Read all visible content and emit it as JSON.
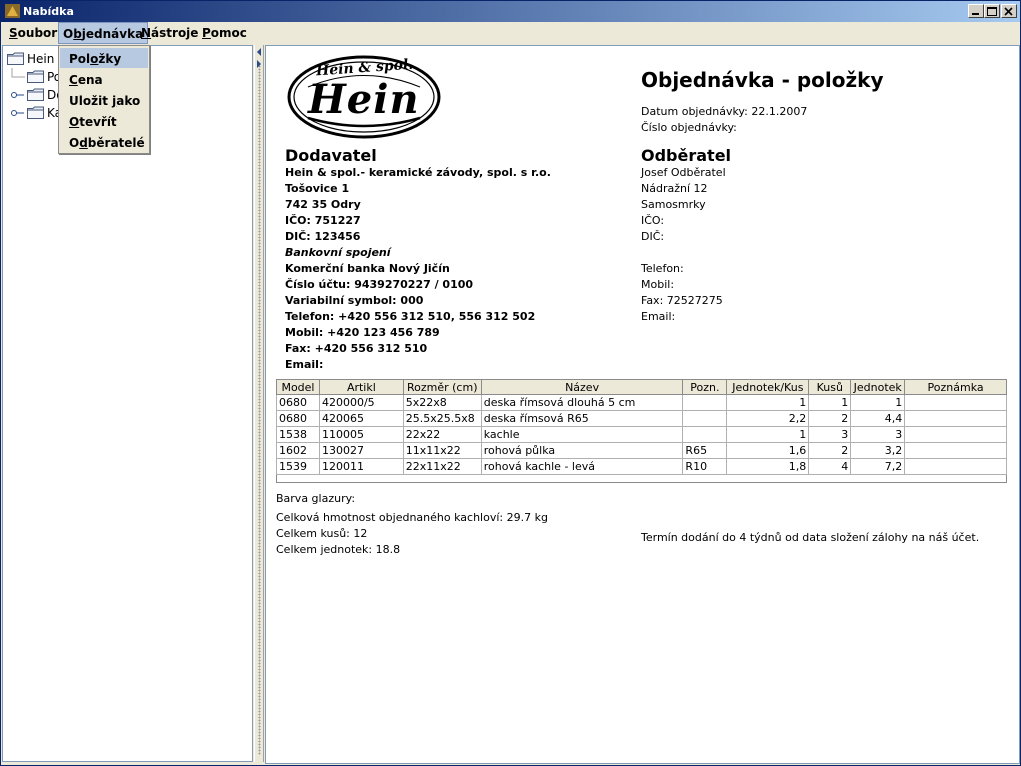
{
  "window": {
    "title": "Nabídka",
    "controls": [
      "minimize",
      "maximize",
      "close"
    ]
  },
  "menubar": {
    "items": [
      {
        "label_pre": "",
        "mnemonic": "S",
        "label_post": "oubor"
      },
      {
        "label_pre": "O",
        "mnemonic": "b",
        "label_post": "jednávka"
      },
      {
        "label_pre": "",
        "mnemonic": "N",
        "label_post": "ástroje"
      },
      {
        "label_pre": "",
        "mnemonic": "P",
        "label_post": "omoc"
      }
    ]
  },
  "dropdown": {
    "items": [
      {
        "label_pre": "Pol",
        "mnemonic": "o",
        "label_post": "žky"
      },
      {
        "label_pre": "",
        "mnemonic": "C",
        "label_post": "ena"
      },
      {
        "label_pre": "Uložit ",
        "mnemonic": "j",
        "label_post": "ako"
      },
      {
        "label_pre": "",
        "mnemonic": "O",
        "label_post": "tevřít"
      },
      {
        "label_pre": "O",
        "mnemonic": "d",
        "label_post": "běratelé"
      }
    ]
  },
  "tree": {
    "root": "Hein",
    "children": [
      "Po",
      "Do",
      "Ka"
    ]
  },
  "document": {
    "logo": {
      "top_text": "Hein & spol.",
      "main_text": "Hein"
    },
    "title": "Objednávka - položky",
    "order_date": "Datum objednávky: 22.1.2007",
    "order_number": "Číslo objednávky:",
    "supplier": {
      "heading": "Dodavatel",
      "lines": [
        "Hein & spol.- keramické závody, spol. s r.o.",
        "Tošovice 1",
        "742 35 Odry",
        "IČO: 751227",
        "DIČ: 123456"
      ],
      "bank_heading": "Bankovní spojení",
      "bank_lines": [
        "Komerční banka Nový Jičín",
        "Číslo účtu: 9439270227 / 0100",
        "Variabilní symbol: 000",
        "Telefon: +420 556 312 510, 556 312 502",
        "Mobil: +420 123 456 789",
        "Fax: +420 556 312 510",
        "Email:"
      ]
    },
    "customer": {
      "heading": "Odběratel",
      "lines": [
        "Josef Odběratel",
        "Nádražní 12",
        "Samosmrky",
        "IČO:",
        "DIČ:"
      ],
      "contact_lines": [
        "Telefon:",
        "Mobil:",
        "Fax: 72527275",
        "Email:"
      ]
    },
    "table": {
      "columns": [
        "Model",
        "Artikl",
        "Rozměr (cm)",
        "Název",
        "Pozn.",
        "Jednotek/Kus",
        "Kusů",
        "Jednotek",
        "Poznámka"
      ],
      "rows": [
        [
          "0680",
          "420000/5",
          "5x22x8",
          "deska římsová dlouhá 5 cm",
          "",
          "1",
          "1",
          "1",
          ""
        ],
        [
          "0680",
          "420065",
          "25.5x25.5x8",
          "deska římsová R65",
          "",
          "2,2",
          "2",
          "4,4",
          ""
        ],
        [
          "1538",
          "110005",
          "22x22",
          "kachle",
          "",
          "1",
          "3",
          "3",
          ""
        ],
        [
          "1602",
          "130027",
          "11x11x22",
          "rohová půlka",
          "R65",
          "1,6",
          "2",
          "3,2",
          ""
        ],
        [
          "1539",
          "120011",
          "22x11x22",
          "rohová kachle - levá",
          "R10",
          "1,8",
          "4",
          "7,2",
          ""
        ]
      ]
    },
    "glaze": "Barva glazury:",
    "total_weight": "Celková hmotnost objednaného kachloví: 29.7 kg",
    "total_pieces": "Celkem kusů: 12",
    "total_units": "Celkem jednotek: 18.8",
    "delivery_note": "Termín dodání do 4 týdnů od data složení zálohy na náš účet."
  },
  "colors": {
    "titlebar_start": "#0a246a",
    "titlebar_end": "#a6caf0",
    "menu_highlight": "#b7c9e0"
  }
}
